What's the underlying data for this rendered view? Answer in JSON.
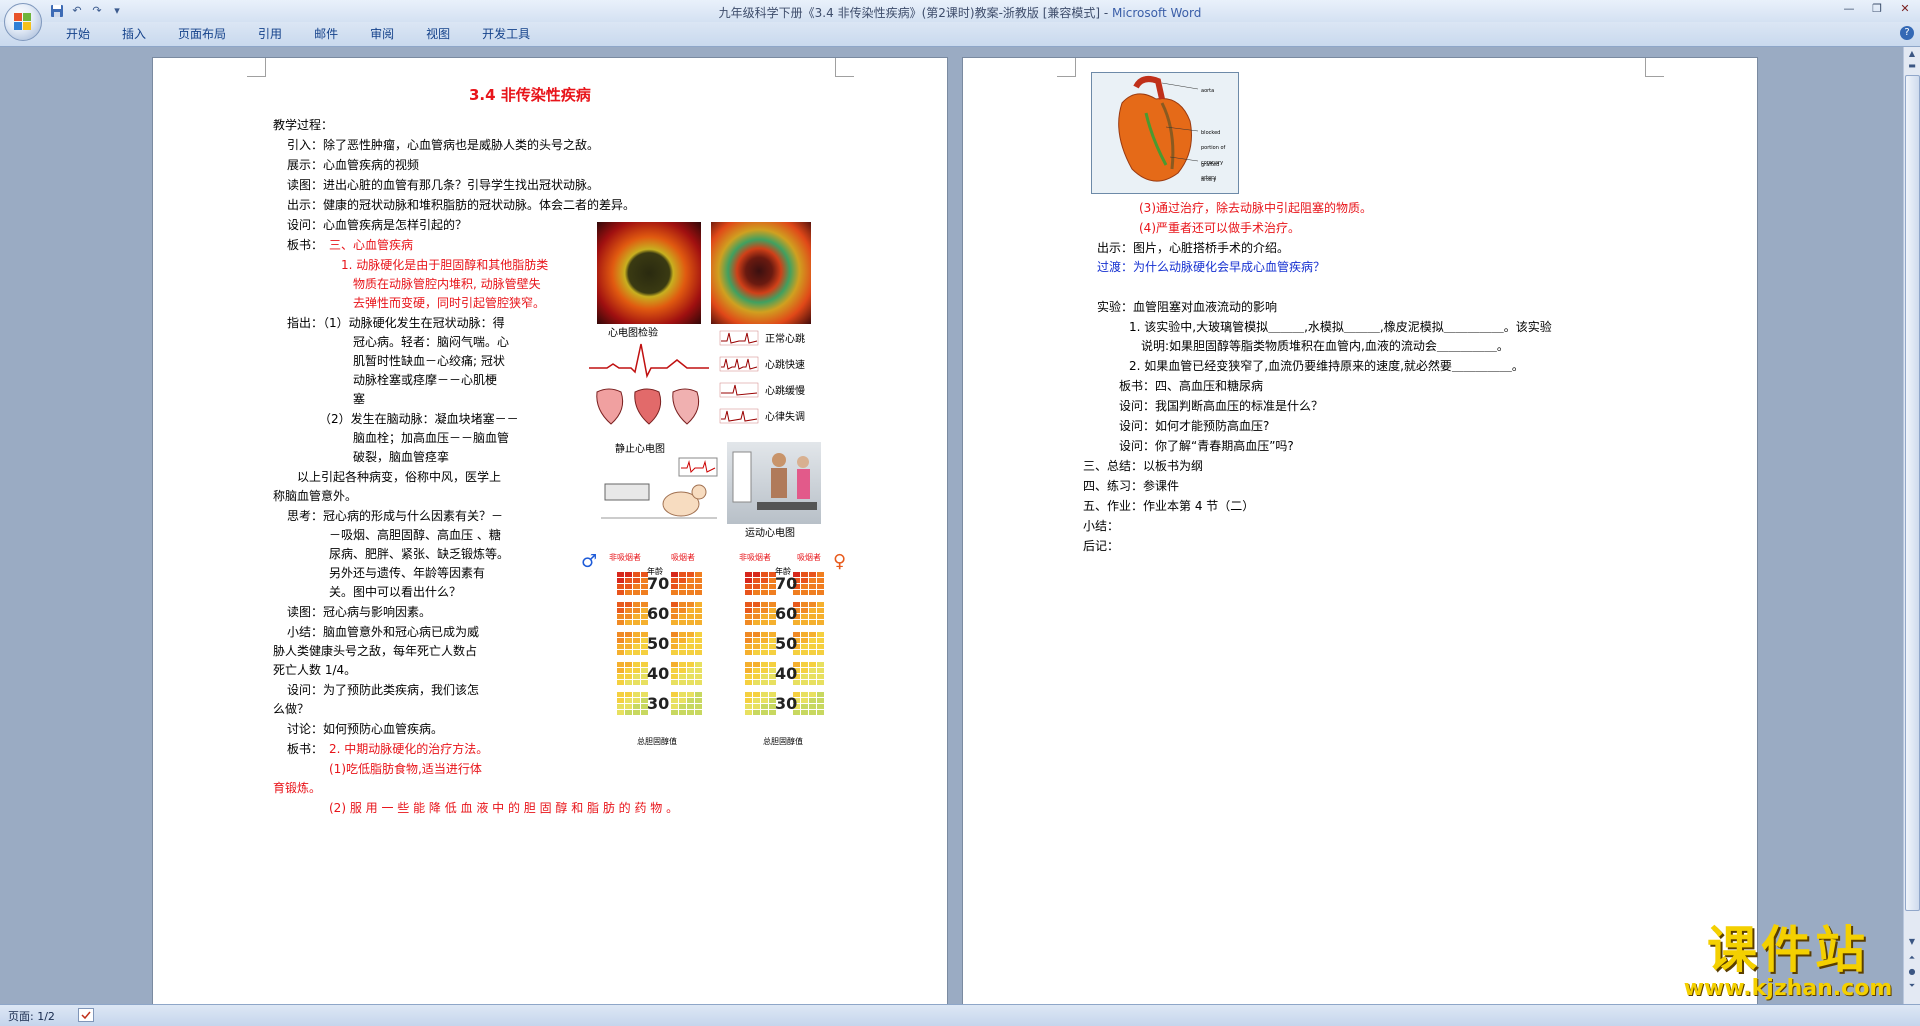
{
  "window": {
    "title": "九年级科学下册《3.4 非传染性疾病》(第2课时)教案-浙教版 [兼容模式] - ",
    "app_name": "Microsoft Word",
    "quick_access": [
      "save-icon",
      "undo-icon",
      "redo-icon",
      "customize-icon"
    ]
  },
  "ribbon": {
    "tabs": [
      "开始",
      "插入",
      "页面布局",
      "引用",
      "邮件",
      "审阅",
      "视图",
      "开发工具"
    ]
  },
  "page1": {
    "heading": "3.4  非传染性疾病",
    "lines": [
      "教学过程：",
      "引入：除了恶性肿瘤，心血管病也是威胁人类的头号之敌。",
      "展示：心血管疾病的视频",
      "读图：进出心脏的血管有那几条？引导学生找出冠状动脉。",
      "出示：健康的冠状动脉和堆积脂肪的冠状动脉。体会二者的差异。",
      "设问：心血管疾病是怎样引起的？",
      "板书：",
      "三、心血管疾病",
      "1. 动脉硬化是由于胆固醇和其他脂肪类",
      "物质在动脉管腔内堆积, 动脉管壁失",
      "去弹性而变硬，同时引起管腔狭窄。",
      "指出：（1）动脉硬化发生在冠状动脉：得",
      "冠心病。轻者：脑闷气喘。心",
      "肌暂时性缺血－心绞痛; 冠状",
      "动脉栓塞或痉摩－－心肌梗",
      "塞",
      "（2）发生在脑动脉：凝血块堵塞－－",
      "脑血栓；加高血压－－脑血管",
      "破裂，脑血管痉挛",
      "以上引起各种病变，俗称中风，医学上",
      "称脑血管意外。",
      "思考：冠心病的形成与什么因素有关？－",
      "－吸烟、高胆固醇、高血压  、糖",
      "尿病、肥胖、紧张、缺乏锻炼等。",
      "另外还与遗传、年龄等因素有",
      "关。图中可以看出什么？",
      "读图：冠心病与影响因素。",
      "小结：脑血管意外和冠心病已成为威",
      "胁人类健康头号之敌，每年死亡人数占",
      "死亡人数 1/4。",
      "设问：为了预防此类疾病，我们该怎",
      "么做？",
      "讨论：如何预防心血管疾病。",
      "板书：",
      "2. 中期动脉硬化的治疗方法。",
      "(1)吃低脂肪食物,适当进行体",
      "育锻炼。",
      "(2) 服 用 一 些 能 降 低 血 液 中 的 胆 固 醇 和 脂 肪 的 药 物 。"
    ],
    "figures": {
      "ecg_check_label": "心电图检验",
      "normal": "正常心跳",
      "fast": "心跳快速",
      "slow": "心跳缓慢",
      "irregular": "心律失调",
      "rest_ecg": "静止心电图",
      "exercise_ecg": "运动心电图",
      "ages": [
        "70",
        "60",
        "50",
        "40",
        "30"
      ],
      "nonsmoker": "非吸烟者",
      "smoker": "吸烟者",
      "age_label": "年龄",
      "cholesterol_label": "总胆固醇值"
    }
  },
  "page2": {
    "heart_labels": [
      "aorta",
      "blocked portion of coronary artery",
      "grafted artery"
    ],
    "lines": [
      "(3)通过治疗，除去动脉中引起阻塞的物质。",
      "(4)严重者还可以做手术治疗。",
      "出示：图片，心脏搭桥手术的介绍。",
      "过渡：为什么动脉硬化会早成心血管疾病？",
      "实验：血管阻塞对血液流动的影响",
      "1. 该实验中,大玻璃管模拟＿＿＿,水模拟＿＿＿,橡皮泥模拟＿＿＿＿＿。该实验",
      "说明:如果胆固醇等脂类物质堆积在血管内,血液的流动会＿＿＿＿＿。",
      "2. 如果血管已经变狭窄了,血流仍要维持原来的速度,就必然要＿＿＿＿＿。",
      "板书：四、高血压和糖尿病",
      "设问：我国判断高血压的标准是什么？",
      "设问：如何才能预防高血压?",
      "设问：你了解“青春期高血压”吗?",
      "三、总结：以板书为纲",
      "四、练习：参课件",
      "五、作业：作业本第 4 节（二）",
      "小结：",
      "后记："
    ]
  },
  "status": {
    "page": "页面: 1/2"
  },
  "watermark": {
    "title": "课件站",
    "url": "www.kjzhan.com"
  },
  "colors": {
    "red_text": "#e8141a",
    "blue_text": "#1530d0",
    "workspace": "#9aabc3"
  }
}
